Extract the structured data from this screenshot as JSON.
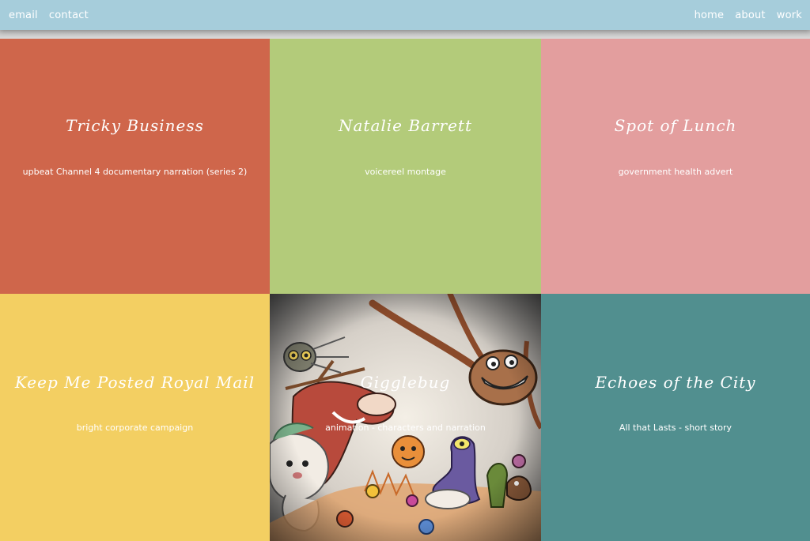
{
  "nav": {
    "left": [
      "email",
      "contact"
    ],
    "right": [
      "home",
      "about",
      "work"
    ]
  },
  "tiles": [
    {
      "title": "Tricky Business",
      "subtitle": "upbeat Channel 4 documentary narration (series 2)",
      "color": "#cf664b"
    },
    {
      "title": "Natalie Barrett",
      "subtitle": "voicereel montage",
      "color": "#b3cb7a"
    },
    {
      "title": "Spot of Lunch",
      "subtitle": "government health advert",
      "color": "#e39e9e"
    },
    {
      "title": "Keep Me Posted Royal Mail",
      "subtitle": "bright corporate campaign",
      "color": "#f3cf62"
    },
    {
      "title": "Gigglebug",
      "subtitle": "animation - characters and narration",
      "color": "#8a8a8a"
    },
    {
      "title": "Echoes of the City",
      "subtitle": "All that Lasts - short story",
      "color": "#518f8f"
    }
  ],
  "colors": {
    "topbar": "#a6cddb",
    "nav_text": "#ffffff"
  },
  "icons": {
    "gigglebug_artwork": "cartoon-characters-illustration"
  }
}
